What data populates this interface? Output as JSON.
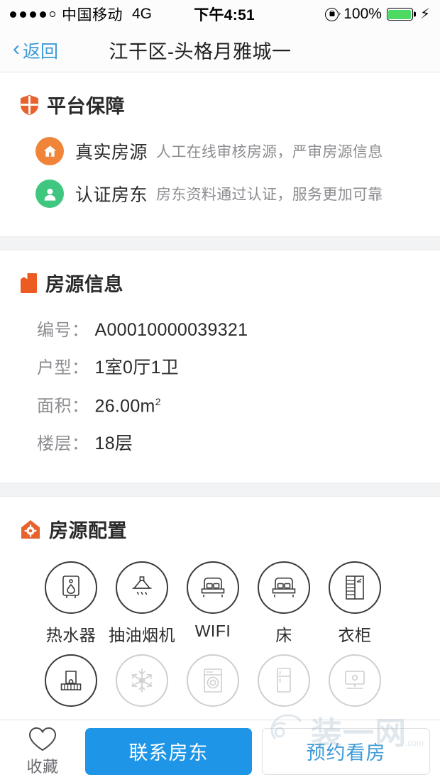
{
  "statusbar": {
    "signal_dots_filled": 4,
    "signal_dots_total": 5,
    "carrier": "中国移动",
    "network": "4G",
    "time": "下午4:51",
    "lock_icon": "rotation-lock-icon",
    "battery_percent": "100%",
    "battery_level": 100,
    "charging": true,
    "battery_color": "#4CD964"
  },
  "navbar": {
    "back_label": "返回",
    "back_icon": "chevron-left-icon",
    "title": "江干区-头格月雅城一",
    "accent_color": "#3E9BD8"
  },
  "guarantee": {
    "icon": "shield-icon",
    "icon_color": "#E8622D",
    "title": "平台保障",
    "items": [
      {
        "icon": "house-circle-icon",
        "icon_bg": "#F08438",
        "label": "真实房源",
        "desc": "人工在线审核房源，严审房源信息"
      },
      {
        "icon": "person-circle-icon",
        "icon_bg": "#3FC77F",
        "label": "认证房东",
        "desc": "房东资料通过认证，服务更加可靠"
      }
    ]
  },
  "house_info": {
    "icon": "bookmark-icon",
    "icon_color": "#EC5B22",
    "title": "房源信息",
    "rows": [
      {
        "label": "编号：",
        "value": "A00010000039321"
      },
      {
        "label": "户型：",
        "value": "1室0厅1卫"
      },
      {
        "label": "面积：",
        "value": "26.00m",
        "sup": "2"
      },
      {
        "label": "楼层：",
        "value": "18层"
      }
    ]
  },
  "amenities": {
    "icon": "house-gear-icon",
    "icon_color": "#E8622D",
    "title": "房源配置",
    "rows": [
      [
        {
          "label": "热水器",
          "icon": "water-heater-icon",
          "available": true
        },
        {
          "label": "抽油烟机",
          "icon": "range-hood-icon",
          "available": true
        },
        {
          "label": "WIFI",
          "icon": "bed-icon",
          "available": true
        },
        {
          "label": "床",
          "icon": "bed-icon",
          "available": true
        },
        {
          "label": "衣柜",
          "icon": "wardrobe-icon",
          "available": true
        }
      ],
      [
        {
          "label": "阳台",
          "icon": "balcony-icon",
          "available": true
        },
        {
          "label": "空调",
          "icon": "snowflake-icon",
          "available": false
        },
        {
          "label": "洗衣机",
          "icon": "washing-machine-icon",
          "available": false
        },
        {
          "label": "冰箱",
          "icon": "refrigerator-icon",
          "available": false
        },
        {
          "label": "电视",
          "icon": "television-icon",
          "available": false
        }
      ]
    ]
  },
  "bottombar": {
    "favorite": {
      "icon": "heart-outline-icon",
      "label": "收藏"
    },
    "primary_button": {
      "label": "联系房东",
      "color": "#1E95E6"
    },
    "ghost_button": {
      "label": "预约看房",
      "color": "#3E9BD8"
    }
  },
  "watermark": {
    "text": "装一网",
    "domain": ".com"
  }
}
